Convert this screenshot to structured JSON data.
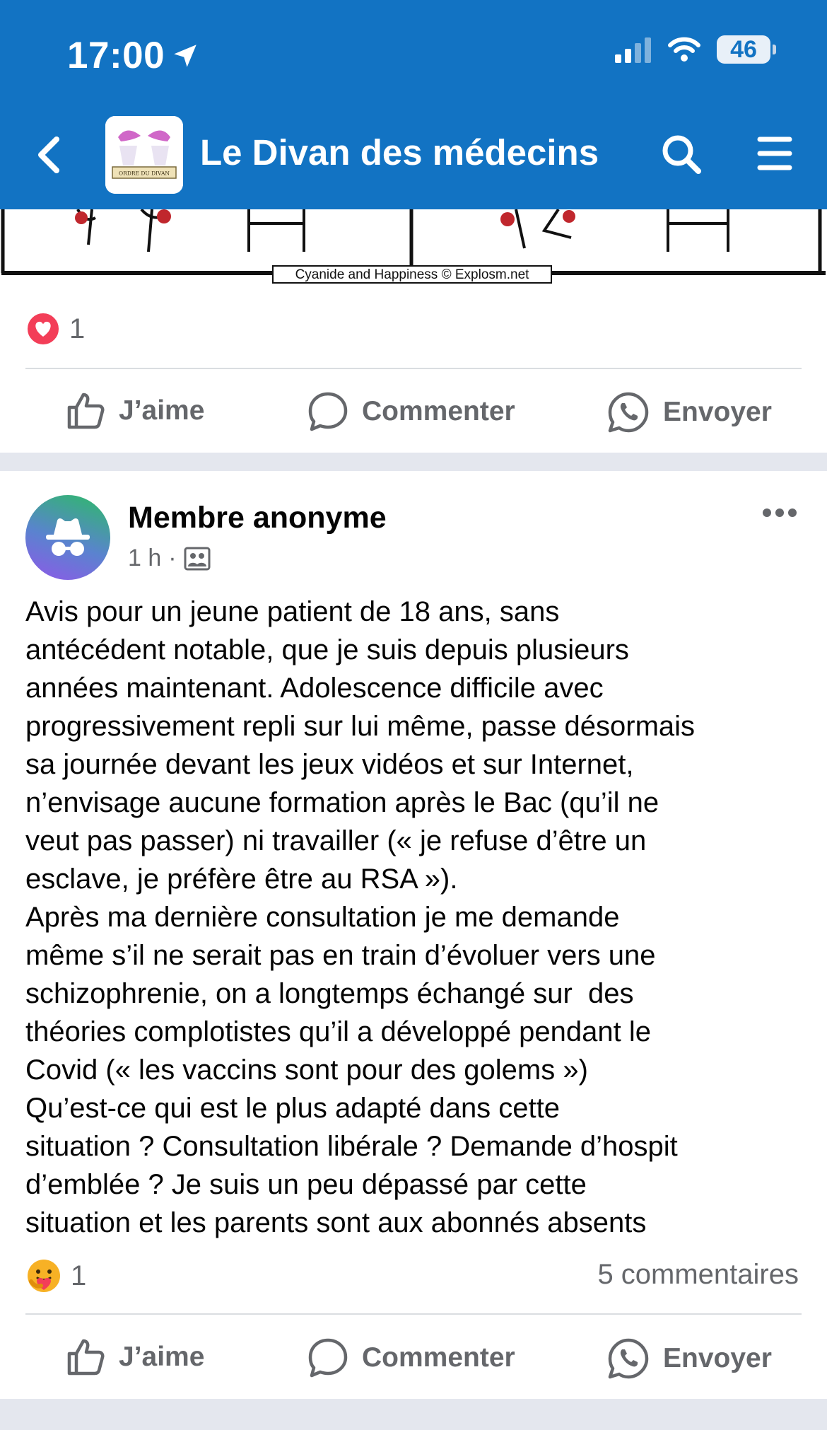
{
  "status_bar": {
    "time": "17:00",
    "battery": "46"
  },
  "header": {
    "title": "Le Divan des médecins",
    "logo_text": "ORDRE DU DIVAN",
    "color": "#1273c3"
  },
  "comic": {
    "credit": "Cyanide and Happiness © Explosm.net"
  },
  "post1": {
    "reaction_count": "1",
    "actions": {
      "like": "J’aime",
      "comment": "Commenter",
      "send": "Envoyer"
    }
  },
  "post2": {
    "author": "Membre anonyme",
    "time": "1 h",
    "separator": "·",
    "text": "Avis pour un jeune patient de 18 ans, sans\nantécédent notable, que je suis depuis plusieurs\nannées maintenant. Adolescence difficile avec\nprogressivement repli sur lui même, passe désormais\nsa journée devant les jeux vidéos et sur Internet,\nn’envisage aucune formation après le Bac (qu’il ne\nveut pas passer) ni travailler (« je refuse d’être un\nesclave, je préfère être au RSA »).\nAprès ma dernière consultation je me demande\nmême s’il ne serait pas en train d’évoluer vers une\nschizophrenie, on a longtemps échangé sur  des\nthéories complotistes qu’il a développé pendant le\nCovid (« les vaccins sont pour des golems »)\nQu’est-ce qui est le plus adapté dans cette\nsituation ? Consultation libérale ? Demande d’hospit\nd’emblée ? Je suis un peu dépassé par cette\nsituation et les parents sont aux abonnés absents",
    "reaction_count": "1",
    "comments": "5 commentaires",
    "actions": {
      "like": "J’aime",
      "comment": "Commenter",
      "send": "Envoyer"
    }
  }
}
